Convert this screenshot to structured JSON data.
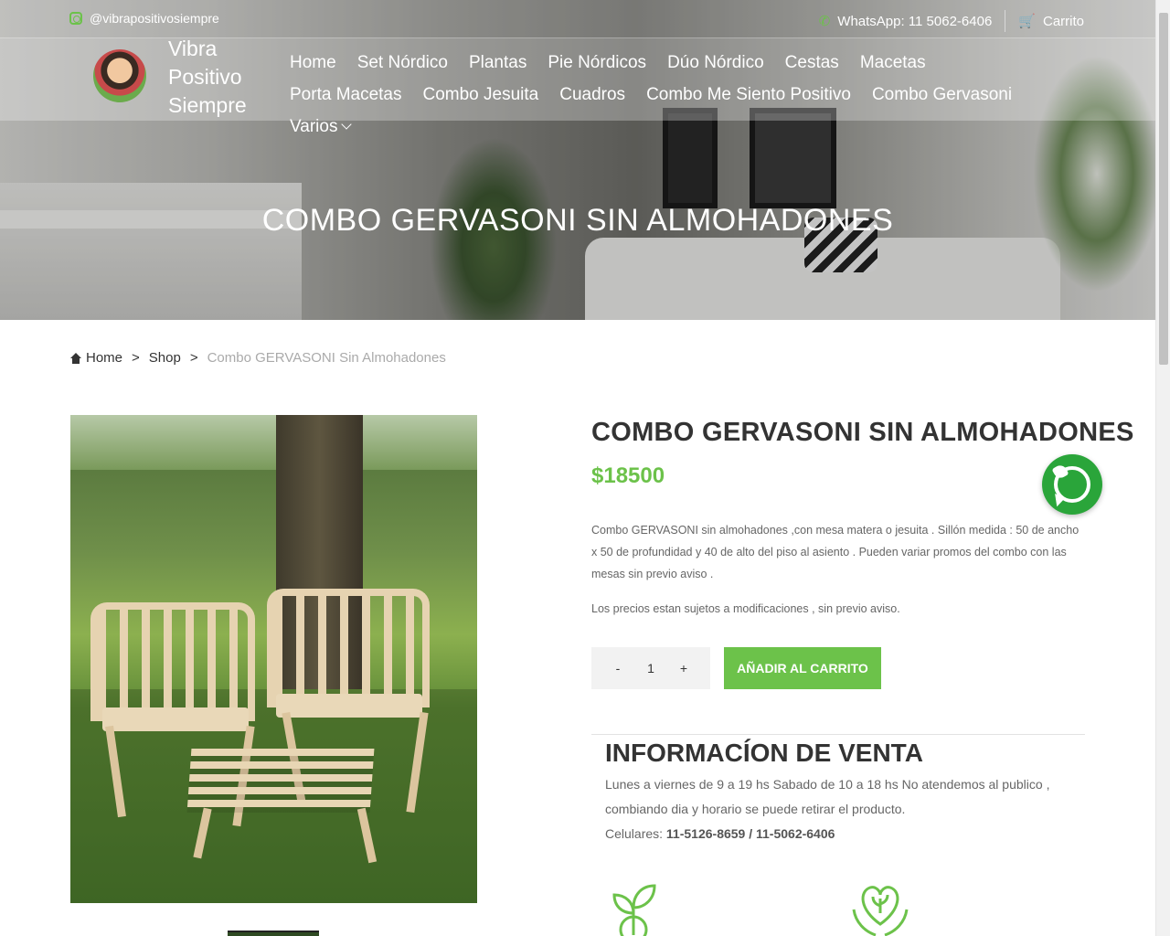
{
  "topbar": {
    "instagram": "@vibrapositivosiempre",
    "whatsapp": "WhatsApp: 11 5062-6406",
    "cart": "Carrito"
  },
  "brand": {
    "line1": "Vibra",
    "line2": "Positivo",
    "line3": "Siempre"
  },
  "nav": {
    "items": [
      "Home",
      "Set Nórdico",
      "Plantas",
      "Pie Nórdicos",
      "Dúo Nórdico",
      "Cestas",
      "Macetas",
      "Porta Macetas",
      "Combo Jesuita",
      "Cuadros",
      "Combo Me Siento Positivo",
      "Combo Gervasoni",
      "Varios"
    ]
  },
  "hero": {
    "title": "COMBO GERVASONI SIN ALMOHADONES"
  },
  "breadcrumb": {
    "home": "Home",
    "sep1": ">",
    "shop": "Shop",
    "sep2": ">",
    "current": "Combo GERVASONI Sin Almohadones"
  },
  "product": {
    "title": "COMBO GERVASONI SIN ALMOHADONES",
    "price": "$18500",
    "description": "Combo GERVASONI sin almohadones ,con mesa matera o jesuita . Sillón medida : 50 de ancho x 50 de profundidad y 40 de alto del piso al asiento . Pueden variar promos del combo con las mesas sin previo aviso .",
    "note": "Los precios estan sujetos a modificaciones , sin previo aviso.",
    "qty_minus": "-",
    "qty_value": "1",
    "qty_plus": "+",
    "add_to_cart": "AÑADIR AL CARRITO"
  },
  "info": {
    "title": "INFORMACÍON DE VENTA",
    "hours": "Lunes a viernes de 9 a 19 hs Sabado de 10 a 18 hs No atendemos al publico , combiando dia y horario se puede retirar el producto.",
    "phones_label": "Celulares:",
    "phones": "11-5126-8659 / 11-5062-6406"
  },
  "colors": {
    "accent": "#6cc24a",
    "whatsapp": "#2aa53a"
  }
}
